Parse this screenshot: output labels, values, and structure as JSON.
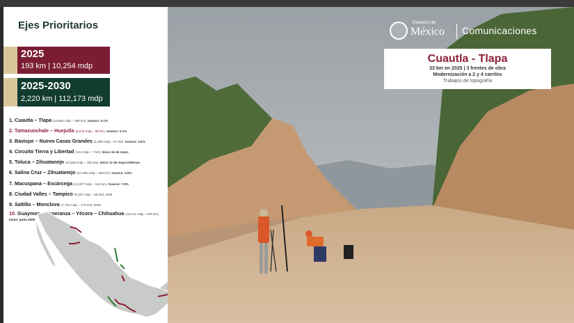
{
  "header": {
    "gob_small": "Gobierno de",
    "gob_big": "México",
    "ministry": "Comunicaciones"
  },
  "panel": {
    "title": "Ejes Prioritarios",
    "band_2025": {
      "year": "2025",
      "summary": "193 km | 10,254 mdp"
    },
    "band_2030": {
      "year": "2025-2030",
      "summary": "2,220 km | 112,173 mdp"
    },
    "items": [
      {
        "num": "1.",
        "name": "Cuautla – Tlapa",
        "detail": "(13,652 mdp – 385 km)",
        "status": "Avance: 0.1%",
        "highlight": false
      },
      {
        "num": "2.",
        "name": "Tamazunchale – Huejutla",
        "detail": "(5,678 mdp – 96 km)",
        "status": "Avance: 0.1%",
        "highlight": true
      },
      {
        "num": "3.",
        "name": "Bavispe – Nuevo Casas Grandes",
        "detail": "(1,859 mdp – 67 km)",
        "status": "Avance: 4.5%",
        "highlight": false
      },
      {
        "num": "4.",
        "name": "Circuito Tierra y Libertad",
        "detail": "(124 mdp – 7 km)",
        "status": "Inicio 16 de mayo",
        "highlight": false
      },
      {
        "num": "5.",
        "name": "Toluca – Zihuatanejo",
        "detail": "(10,580 mdp – 482 km)",
        "status": "Inicio 12 de mayo Defensa",
        "highlight": false
      },
      {
        "num": "6.",
        "name": "Salina Cruz – Zihuatanejo",
        "detail": "(27,665 mdp – 453 km)",
        "status": "Avance: 3.9%",
        "highlight": false
      },
      {
        "num": "7.",
        "name": "Macuspana – Escárcega",
        "detail": "(11,607 mdp – 124 km)",
        "status": "Avance: 7.8%",
        "highlight": false
      },
      {
        "num": "8.",
        "name": "Ciudad Valles – Tampico",
        "detail": "(9,397 mdp – 68 km)",
        "status": "2026",
        "highlight": false
      },
      {
        "num": "9.",
        "name": "Saltillo – Monclova",
        "detail": "(7,724 mdp – 179 km)",
        "status": "2026",
        "highlight": false
      },
      {
        "num": "10.",
        "name": "Guaymas – Esperanza – Yécora – Chihuahua",
        "detail": "(18,141 mdp – 349 km)",
        "status": "Inicio: junio 2025",
        "highlight": false
      }
    ]
  },
  "card": {
    "title": "Cuautla - Tlapa",
    "line1": "33 km en 2025 | 3 frentes de obra",
    "line2": "Modernización a 2 y 4 carriles",
    "line3": "Trabajos de topografía"
  },
  "colors": {
    "guinda": "#7a1d33",
    "verde": "#123c30",
    "dorado": "#d9c79c"
  }
}
